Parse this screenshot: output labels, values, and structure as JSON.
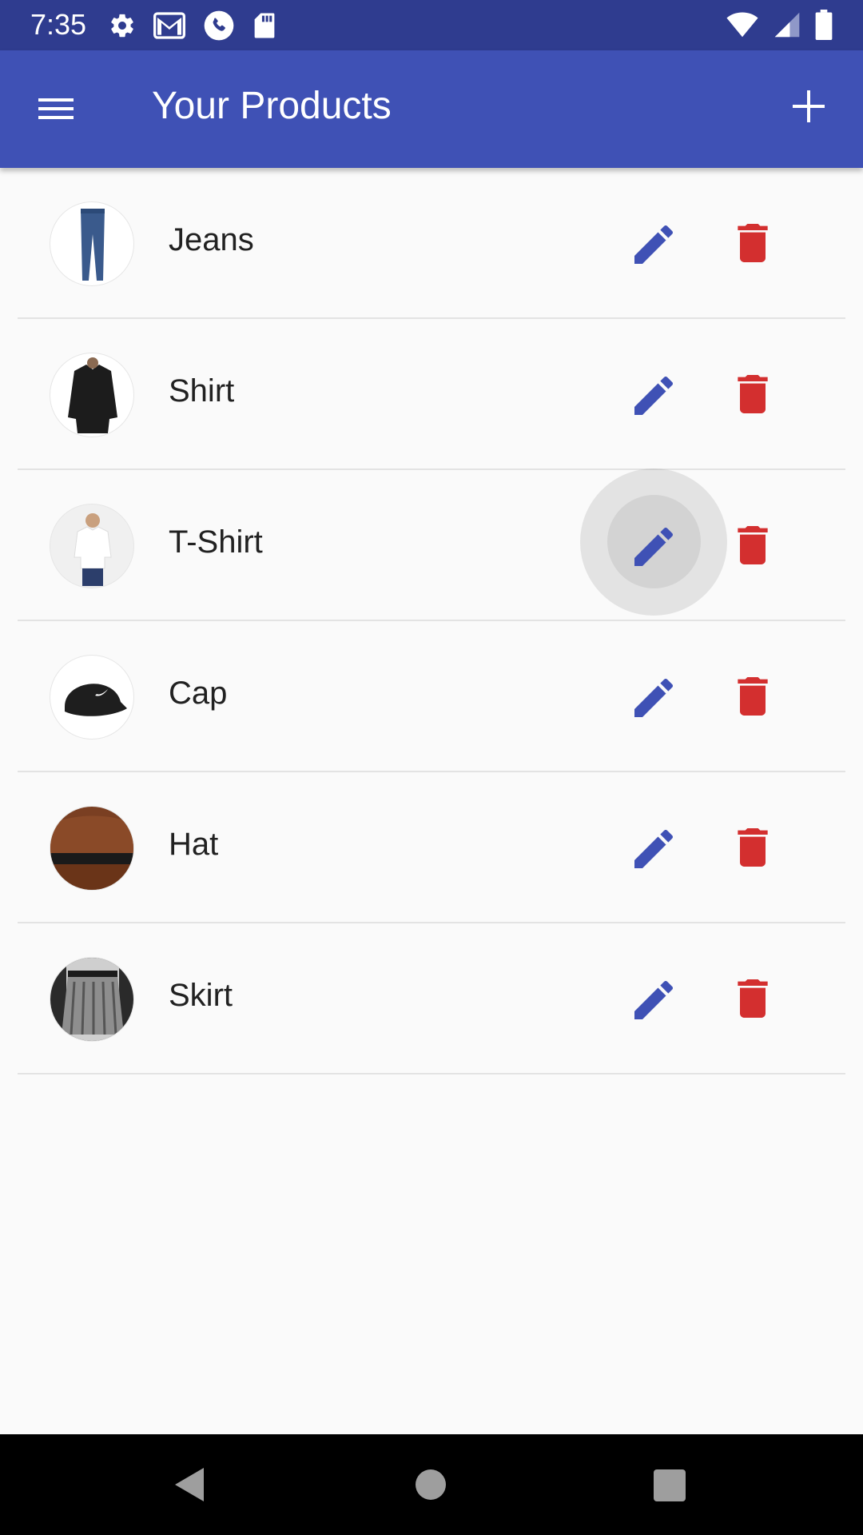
{
  "status_bar": {
    "time": "7:35",
    "left_icons": [
      "settings-icon",
      "gmail-icon",
      "phone-icon",
      "sd-card-icon"
    ],
    "right_icons": [
      "wifi-icon",
      "cell-signal-icon",
      "battery-icon"
    ]
  },
  "app_bar": {
    "title": "Your Products",
    "menu_icon": "hamburger-menu-icon",
    "add_icon": "plus-icon",
    "color": "#3f51b5"
  },
  "products": [
    {
      "label": "Jeans",
      "thumb": "jeans-thumbnail"
    },
    {
      "label": "Shirt",
      "thumb": "shirt-thumbnail"
    },
    {
      "label": "T-Shirt",
      "thumb": "t-shirt-thumbnail"
    },
    {
      "label": "Cap",
      "thumb": "cap-thumbnail"
    },
    {
      "label": "Hat",
      "thumb": "hat-thumbnail"
    },
    {
      "label": "Skirt",
      "thumb": "skirt-thumbnail"
    }
  ],
  "colors": {
    "edit": "#3f51b5",
    "delete": "#d32f2f",
    "status_bar": "#2f3c8f"
  },
  "nav_bar": {
    "icons": [
      "back-icon",
      "home-icon",
      "recents-icon"
    ]
  }
}
